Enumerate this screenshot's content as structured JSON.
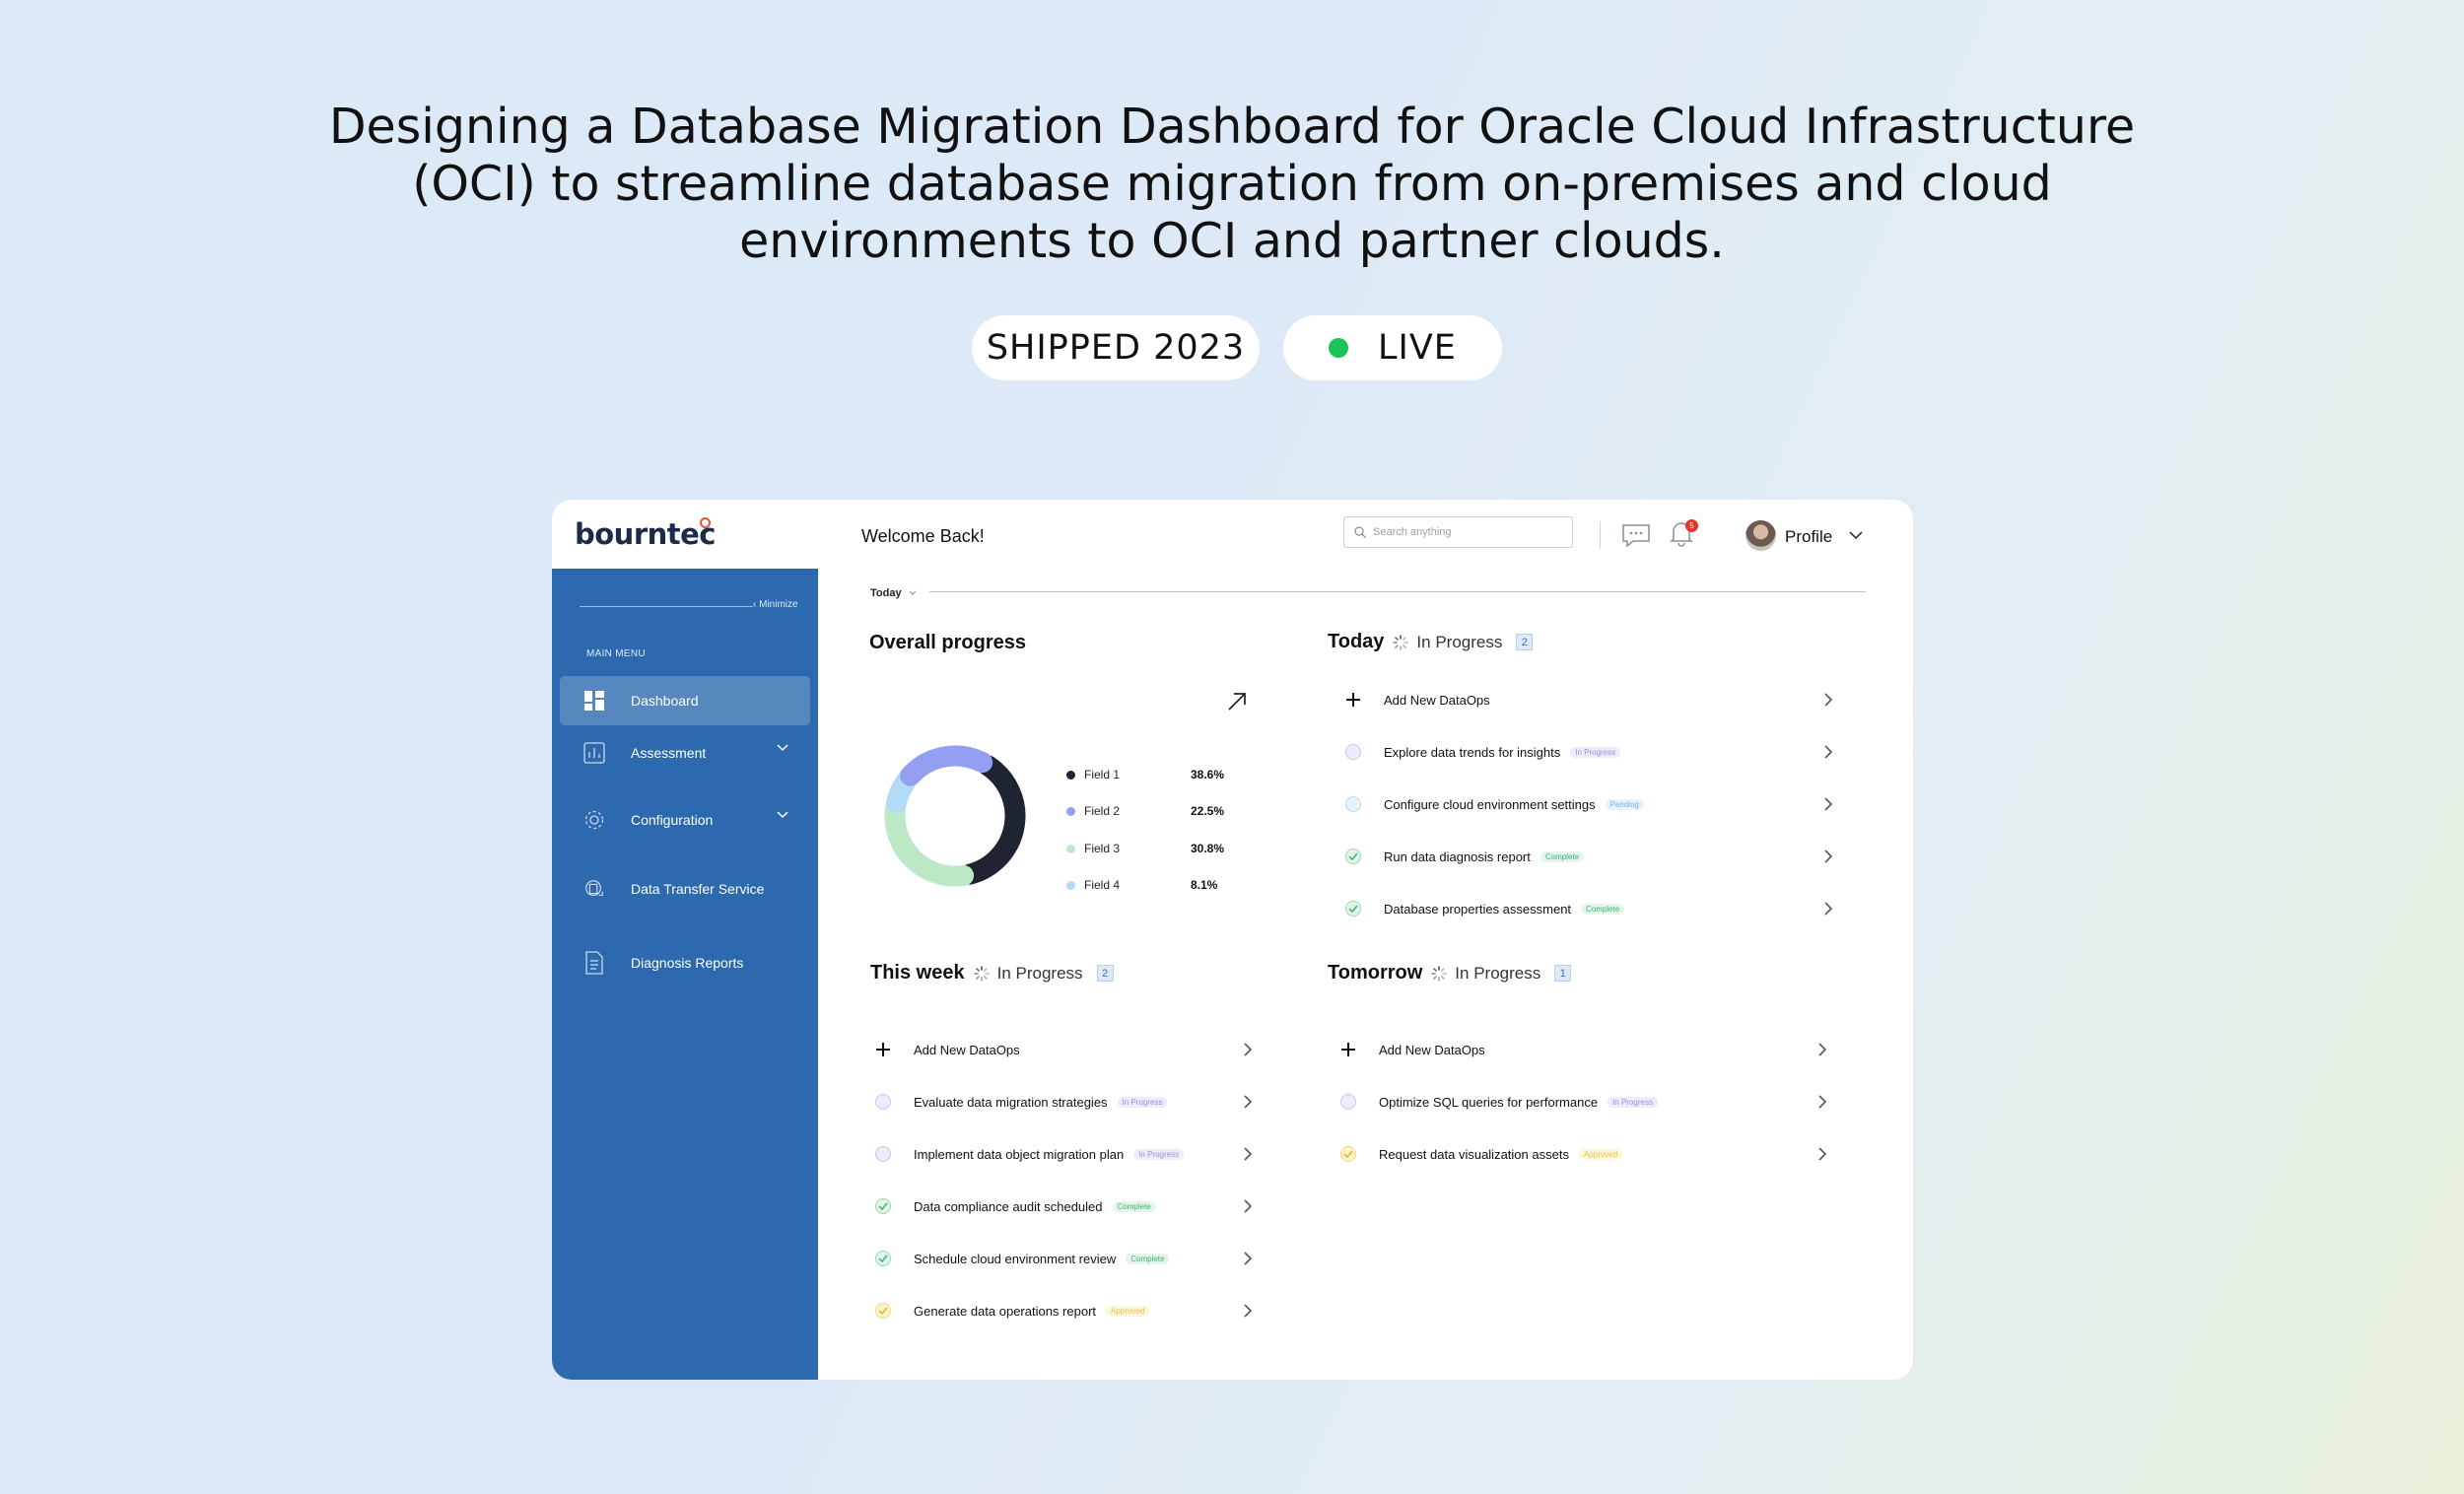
{
  "headline": "Designing a Database Migration Dashboard for Oracle Cloud Infrastructure (OCI) to streamline database migration from on-premises and cloud environments to OCI and partner clouds.",
  "badges": {
    "shipped": "SHIPPED 2023",
    "live": "LIVE",
    "live_color": "#1bc45b"
  },
  "app": {
    "logo": "bourntec",
    "sidebar": {
      "minimize": "‹ Minimize",
      "main_menu": "MAIN MENU",
      "items": [
        {
          "label": "Dashboard",
          "icon": "dashboard-icon",
          "active": true
        },
        {
          "label": "Assessment",
          "icon": "chart-icon",
          "has_submenu": true
        },
        {
          "label": "Configuration",
          "icon": "gear-icon",
          "has_submenu": true
        },
        {
          "label": "Data Transfer Service",
          "icon": "transfer-icon"
        },
        {
          "label": "Diagnosis Reports",
          "icon": "report-icon"
        }
      ]
    },
    "header": {
      "welcome": "Welcome Back!",
      "search_placeholder": "Search anything",
      "notification_count": "5",
      "profile": "Profile"
    },
    "filter": "Today",
    "overall_progress": {
      "title": "Overall progress"
    },
    "today": {
      "title": "Today",
      "status": "In Progress",
      "count": "2"
    },
    "this_week": {
      "title": "This week",
      "status": "In Progress",
      "count": "2"
    },
    "tomorrow": {
      "title": "Tomorrow",
      "status": "In Progress",
      "count": "1"
    },
    "lists": {
      "today": [
        {
          "label": "Add New DataOps",
          "type": "add"
        },
        {
          "label": "Explore data trends for insights",
          "type": "inprogress",
          "tag": "In Progress"
        },
        {
          "label": "Configure cloud environment settings",
          "type": "pending",
          "tag": "Pending"
        },
        {
          "label": "Run data diagnosis report",
          "type": "complete",
          "tag": "Complete"
        },
        {
          "label": "Database properties assessment",
          "type": "complete",
          "tag": "Complete"
        }
      ],
      "this_week": [
        {
          "label": "Add New DataOps",
          "type": "add"
        },
        {
          "label": "Evaluate data migration strategies",
          "type": "inprogress",
          "tag": "In Progress"
        },
        {
          "label": "Implement data object migration plan",
          "type": "inprogress",
          "tag": "In Progress"
        },
        {
          "label": "Data compliance audit scheduled",
          "type": "complete",
          "tag": "Complete"
        },
        {
          "label": "Schedule cloud environment review",
          "type": "complete",
          "tag": "Complete"
        },
        {
          "label": "Generate data operations report",
          "type": "approved",
          "tag": "Approved"
        }
      ],
      "tomorrow": [
        {
          "label": "Add New DataOps",
          "type": "add"
        },
        {
          "label": "Optimize SQL queries for performance",
          "type": "inprogress",
          "tag": "In Progress"
        },
        {
          "label": "Request data visualization assets",
          "type": "approved",
          "tag": "Approved"
        }
      ]
    }
  },
  "chart_data": {
    "type": "pie",
    "style": "donut",
    "categories": [
      "Field 1",
      "Field 2",
      "Field 3",
      "Field 4"
    ],
    "values": [
      38.6,
      22.5,
      30.8,
      8.1
    ],
    "value_labels": [
      "38.6%",
      "22.5%",
      "30.8%",
      "8.1%"
    ],
    "colors": [
      "#1f2433",
      "#939ff2",
      "#bde8c6",
      "#b2dcf6"
    ]
  }
}
